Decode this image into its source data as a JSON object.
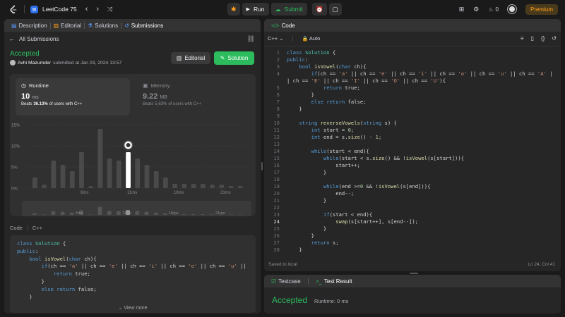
{
  "topbar": {
    "list_title": "LeetCode 75",
    "run": "Run",
    "submit": "Submit",
    "streak": "0",
    "premium": "Premium"
  },
  "left": {
    "tabs": [
      {
        "label": "Description"
      },
      {
        "label": "Editorial"
      },
      {
        "label": "Solutions"
      },
      {
        "label": "Submissions"
      }
    ],
    "back": "All Submissions",
    "status": "Accepted",
    "author": "Avhi Mazumder",
    "submitted": "submitted at Jan 23, 2024 13:57",
    "editorial_btn": "Editorial",
    "solution_btn": "Solution",
    "runtime": {
      "label": "Runtime",
      "value": "10",
      "unit": "ms",
      "beats_pre": "Beats",
      "beats": "36.13%",
      "beats_post": "of users with C++"
    },
    "memory": {
      "label": "Memory",
      "value": "9.22",
      "unit": "MB",
      "beats_pre": "Beats",
      "beats": "5.63%",
      "beats_post": "of users with C++"
    },
    "code_label": "Code",
    "lang_label": "C++",
    "view_more": "View more"
  },
  "chart_data": {
    "type": "bar",
    "ylabels": [
      "15%",
      "10%",
      "5%",
      "0%"
    ],
    "ylim": [
      0,
      15
    ],
    "xlabels": [
      "6ms",
      "11ms",
      "16ms",
      "21ms"
    ],
    "values": [
      2.5,
      0.8,
      6.5,
      5.5,
      4,
      8.5,
      0.5,
      14,
      7,
      6.5,
      8.5,
      7,
      5.5,
      4,
      2.5,
      1,
      1,
      1,
      1,
      0.8,
      0.8,
      0.5,
      0.5
    ],
    "highlight_index": 10,
    "mini_labels": [
      "6ms",
      "11ms",
      "16ms",
      "21ms"
    ]
  },
  "right": {
    "title": "Code",
    "lang": "C++",
    "auto": "Auto",
    "saved": "Saved to local",
    "cursor": "Ln 24, Col 41",
    "bottom_tabs": {
      "testcase": "Testcase",
      "result": "Test Result"
    },
    "result": {
      "status": "Accepted",
      "runtime": "Runtime: 0 ms"
    }
  },
  "editor_lines": [
    {
      "n": "1",
      "t": "class Solution {"
    },
    {
      "n": "2",
      "t": "public:"
    },
    {
      "n": "3",
      "t": "    bool isVowel(char ch){"
    },
    {
      "n": "4",
      "t": "        if(ch == 'a' || ch == 'e' || ch == 'i' || ch == 'o' || ch == 'u' || ch == 'A' |"
    },
    {
      "n": "",
      "t": "| ch == 'E' || ch == 'I' || ch == 'O' || ch == 'U'){"
    },
    {
      "n": "5",
      "t": "            return true;"
    },
    {
      "n": "6",
      "t": "        }"
    },
    {
      "n": "7",
      "t": "        else return false;"
    },
    {
      "n": "8",
      "t": "    }"
    },
    {
      "n": "9",
      "t": ""
    },
    {
      "n": "10",
      "t": "    string reverseVowels(string s) {"
    },
    {
      "n": "11",
      "t": "        int start = 0;"
    },
    {
      "n": "12",
      "t": "        int end = s.size() - 1;"
    },
    {
      "n": "13",
      "t": ""
    },
    {
      "n": "14",
      "t": "        while(start < end){"
    },
    {
      "n": "15",
      "t": "            while(start < s.size() && !isVowel(s[start])){"
    },
    {
      "n": "16",
      "t": "                start++;"
    },
    {
      "n": "17",
      "t": "            }"
    },
    {
      "n": "18",
      "t": ""
    },
    {
      "n": "19",
      "t": "            while(end >=0 && !isVowel(s[end])){"
    },
    {
      "n": "20",
      "t": "                end--;"
    },
    {
      "n": "21",
      "t": "            }"
    },
    {
      "n": "22",
      "t": ""
    },
    {
      "n": "23",
      "t": "            if(start < end){"
    },
    {
      "n": "24",
      "t": "                swap(s[start++], s[end--]);"
    },
    {
      "n": "25",
      "t": "            }"
    },
    {
      "n": "26",
      "t": "        }"
    },
    {
      "n": "27",
      "t": "        return s;"
    },
    {
      "n": "28",
      "t": "    }"
    }
  ],
  "preview_lines": [
    "class Solution {",
    "public:",
    "    bool isVowel(char ch){",
    "        if(ch == 'a' || ch == 'e' || ch == 'i' || ch == 'o' || ch == 'u' ||",
    "            return true;",
    "        }",
    "        else return false;",
    "    }"
  ]
}
